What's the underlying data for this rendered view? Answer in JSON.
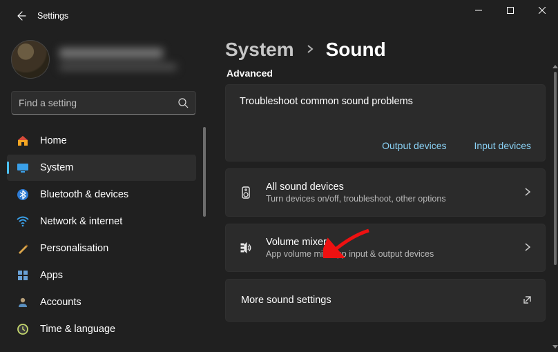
{
  "titlebar": {
    "title": "Settings"
  },
  "search": {
    "placeholder": "Find a setting"
  },
  "sidebar": {
    "items": [
      {
        "label": "Home",
        "icon": "home"
      },
      {
        "label": "System",
        "icon": "system",
        "selected": true
      },
      {
        "label": "Bluetooth & devices",
        "icon": "bluetooth"
      },
      {
        "label": "Network & internet",
        "icon": "wifi"
      },
      {
        "label": "Personalisation",
        "icon": "brush"
      },
      {
        "label": "Apps",
        "icon": "apps"
      },
      {
        "label": "Accounts",
        "icon": "person"
      },
      {
        "label": "Time & language",
        "icon": "clock"
      }
    ]
  },
  "breadcrumb": {
    "parent": "System",
    "current": "Sound"
  },
  "section": {
    "title": "Advanced"
  },
  "troubleshoot": {
    "title": "Troubleshoot common sound problems",
    "output_link": "Output devices",
    "input_link": "Input devices"
  },
  "rows": {
    "all_devices": {
      "title": "All sound devices",
      "sub": "Turn devices on/off, troubleshoot, other options"
    },
    "volume_mixer": {
      "title": "Volume mixer",
      "sub": "App volume mix, app input & output devices"
    },
    "more_settings": {
      "title": "More sound settings"
    }
  }
}
